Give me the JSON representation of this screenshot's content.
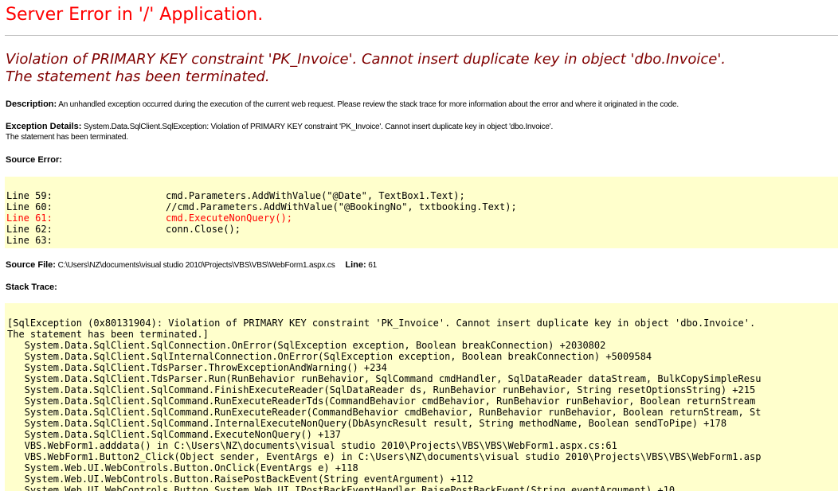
{
  "page": {
    "title": "Server Error in '/' Application."
  },
  "error": {
    "message_line1": "Violation of PRIMARY KEY constraint 'PK_Invoice'. Cannot insert duplicate key in object 'dbo.Invoice'.",
    "message_line2": "The statement has been terminated."
  },
  "description": {
    "label": "Description:",
    "text": "An unhandled exception occurred during the execution of the current web request. Please review the stack trace for more information about the error and where it originated in the code."
  },
  "exception_details": {
    "label": "Exception Details:",
    "text_line1": "System.Data.SqlClient.SqlException: Violation of PRIMARY KEY constraint 'PK_Invoice'. Cannot insert duplicate key in object 'dbo.Invoice'.",
    "text_line2": "The statement has been terminated."
  },
  "source_error": {
    "label": "Source Error:",
    "lines": [
      {
        "number": "Line 59:",
        "code": "cmd.Parameters.AddWithValue(\"@Date\", TextBox1.Text);",
        "highlight": false
      },
      {
        "number": "Line 60:",
        "code": "//cmd.Parameters.AddWithValue(\"@BookingNo\", txtbooking.Text);",
        "highlight": false
      },
      {
        "number": "Line 61:",
        "code": "cmd.ExecuteNonQuery();",
        "highlight": true
      },
      {
        "number": "Line 62:",
        "code": "conn.Close();",
        "highlight": false
      },
      {
        "number": "Line 63:",
        "code": "",
        "highlight": false
      }
    ]
  },
  "source_file": {
    "label": "Source File:",
    "path": "C:\\Users\\NZ\\documents\\visual studio 2010\\Projects\\VBS\\VBS\\WebForm1.aspx.cs",
    "line_label": "Line:",
    "line_number": "61"
  },
  "stack_trace": {
    "label": "Stack Trace:",
    "lines": [
      "[SqlException (0x80131904): Violation of PRIMARY KEY constraint 'PK_Invoice'. Cannot insert duplicate key in object 'dbo.Invoice'.",
      "The statement has been terminated.]",
      "   System.Data.SqlClient.SqlConnection.OnError(SqlException exception, Boolean breakConnection) +2030802",
      "   System.Data.SqlClient.SqlInternalConnection.OnError(SqlException exception, Boolean breakConnection) +5009584",
      "   System.Data.SqlClient.TdsParser.ThrowExceptionAndWarning() +234",
      "   System.Data.SqlClient.TdsParser.Run(RunBehavior runBehavior, SqlCommand cmdHandler, SqlDataReader dataStream, BulkCopySimpleResu",
      "   System.Data.SqlClient.SqlCommand.FinishExecuteReader(SqlDataReader ds, RunBehavior runBehavior, String resetOptionsString) +215",
      "   System.Data.SqlClient.SqlCommand.RunExecuteReaderTds(CommandBehavior cmdBehavior, RunBehavior runBehavior, Boolean returnStream",
      "   System.Data.SqlClient.SqlCommand.RunExecuteReader(CommandBehavior cmdBehavior, RunBehavior runBehavior, Boolean returnStream, St",
      "   System.Data.SqlClient.SqlCommand.InternalExecuteNonQuery(DbAsyncResult result, String methodName, Boolean sendToPipe) +178",
      "   System.Data.SqlClient.SqlCommand.ExecuteNonQuery() +137",
      "   VBS.WebForm1.adddata() in C:\\Users\\NZ\\documents\\visual studio 2010\\Projects\\VBS\\VBS\\WebForm1.aspx.cs:61",
      "   VBS.WebForm1.Button2_Click(Object sender, EventArgs e) in C:\\Users\\NZ\\documents\\visual studio 2010\\Projects\\VBS\\VBS\\WebForm1.asp",
      "   System.Web.UI.WebControls.Button.OnClick(EventArgs e) +118",
      "   System.Web.UI.WebControls.Button.RaisePostBackEvent(String eventArgument) +112",
      "   System.Web.UI.WebControls.Button.System.Web.UI.IPostBackEventHandler.RaisePostBackEvent(String eventArgument) +10"
    ]
  },
  "colors": {
    "title": "#ff0000",
    "headline": "#800000",
    "code_background": "#ffffcc",
    "highlight_line": "#ff0000",
    "rule": "#c0c0c0"
  }
}
